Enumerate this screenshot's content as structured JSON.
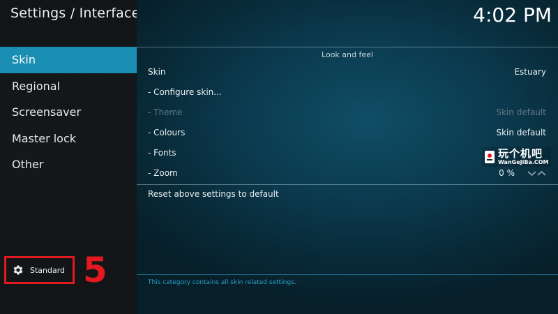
{
  "window": {
    "title": "Settings / Interface",
    "clock": "4:02 PM"
  },
  "sidebar": {
    "items": [
      {
        "label": "Skin",
        "active": true
      },
      {
        "label": "Regional",
        "active": false
      },
      {
        "label": "Screensaver",
        "active": false
      },
      {
        "label": "Master lock",
        "active": false
      },
      {
        "label": "Other",
        "active": false
      }
    ],
    "settings_level": {
      "icon": "gear-icon",
      "label": "Standard"
    }
  },
  "annotation": {
    "number": "5",
    "color": "#e3191f"
  },
  "main": {
    "group_title": "Look and feel",
    "settings": [
      {
        "label": "Skin",
        "value": "Estuary",
        "enabled": true
      },
      {
        "label": "- Configure skin...",
        "value": "",
        "enabled": true
      },
      {
        "label": "- Theme",
        "value": "Skin default",
        "enabled": false
      },
      {
        "label": "- Colours",
        "value": "Skin default",
        "enabled": true
      },
      {
        "label": "- Fonts",
        "value": "",
        "enabled": true
      },
      {
        "label": "- Zoom",
        "value": "0 %",
        "enabled": true
      }
    ],
    "reset_label": "Reset above settings to default",
    "help_text": "This category contains all skin related settings."
  },
  "watermark": {
    "chinese": "玩个机吧",
    "domain": "WanGeJiBa.COM"
  },
  "colors": {
    "accent": "#1a8fb3",
    "sidebar_bg": "#14171a",
    "main_bg": "#0b3a4e",
    "help_text": "#2aa3cc",
    "disabled_text": "#5f7884"
  }
}
